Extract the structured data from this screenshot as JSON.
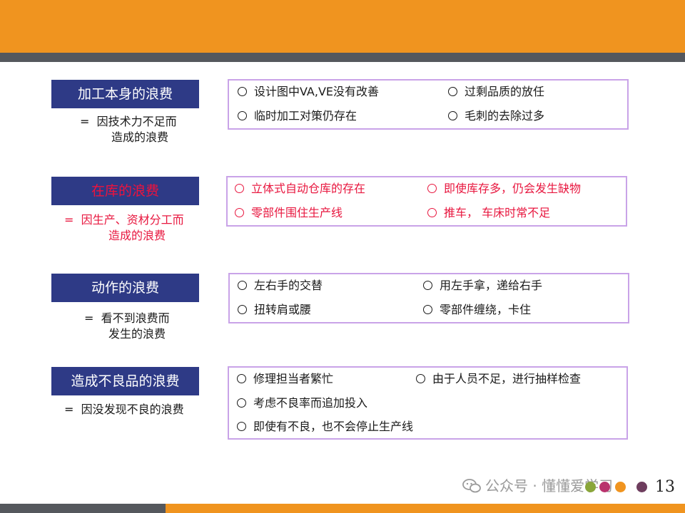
{
  "sections": [
    {
      "category": "加工本身的浪费",
      "desc_line1": "=  因技术力不足而",
      "desc_line2": "造成的浪费",
      "items": [
        "设计图中VA,VE没有改善",
        "过剩品质的放任",
        "临时加工对策仍存在",
        "毛刺的去除过多"
      ]
    },
    {
      "category": "在库的浪费",
      "desc_line1": "=  因生产、资材分工而",
      "desc_line2": "造成的浪费",
      "items": [
        "立体式自动仓库的存在",
        "即使库存多，仍会发生缺物",
        "零部件围住生产线",
        "推车，  车床时常不足"
      ]
    },
    {
      "category": "动作的浪费",
      "desc_line1": "=  看不到浪费而",
      "desc_line2": "发生的浪费",
      "items": [
        "左右手的交替",
        "用左手拿，递给右手",
        "扭转肩或腰",
        "零部件缠绕，卡住"
      ]
    },
    {
      "category": "造成不良品的浪费",
      "desc_line1": "=  因没发现不良的浪费",
      "items": [
        "修理担当者繁忙",
        "由于人员不足，进行抽样检查",
        "考虑不良率而追加投入",
        "即使有不良，也不会停止生产线"
      ]
    }
  ],
  "watermark": "公众号 · 懂懂爱学习",
  "page_number": "13",
  "colors": {
    "orange": "#f0941f",
    "dark_gray": "#55585d",
    "navy": "#2e3a86",
    "red_text": "#e8173f",
    "box_border": "#c9a3e8"
  },
  "icons": {
    "watermark": "wechat-icon",
    "bullet": "circle-bullet-icon"
  }
}
